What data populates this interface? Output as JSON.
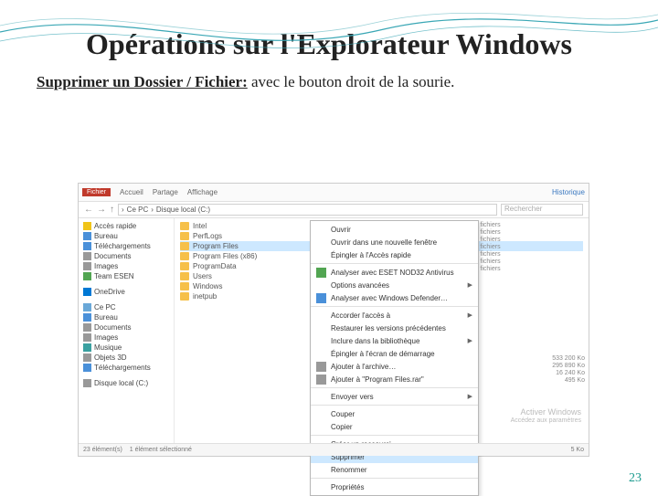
{
  "slide": {
    "title": "Opérations sur l'Explorateur Windows",
    "lead": "Supprimer un  Dossier / Fichier:",
    "rest": " avec le bouton droit de la sourie.",
    "page": "23"
  },
  "explorer": {
    "ribbon": {
      "file": "Fichier",
      "home": "Accueil",
      "share": "Partage",
      "view": "Affichage",
      "history": "Historique"
    },
    "nav": {
      "path_parts": [
        "Ce PC",
        "Disque local (C:)"
      ],
      "search_placeholder": "Rechercher"
    },
    "sidebar": [
      {
        "label": "Accès rapide",
        "icon": "star"
      },
      {
        "label": "Bureau",
        "icon": "blue"
      },
      {
        "label": "Téléchargements",
        "icon": "blue"
      },
      {
        "label": "Documents",
        "icon": "gray"
      },
      {
        "label": "Images",
        "icon": "gray"
      },
      {
        "label": "Team ESEN",
        "icon": "green"
      },
      {
        "sep": true
      },
      {
        "label": "OneDrive",
        "icon": "cloud"
      },
      {
        "sep": true
      },
      {
        "label": "Ce PC",
        "icon": "pc"
      },
      {
        "label": "Bureau",
        "icon": "blue"
      },
      {
        "label": "Documents",
        "icon": "gray"
      },
      {
        "label": "Images",
        "icon": "gray"
      },
      {
        "label": "Musique",
        "icon": "music"
      },
      {
        "label": "Objets 3D",
        "icon": "gray"
      },
      {
        "label": "Téléchargements",
        "icon": "blue"
      },
      {
        "sep": true
      },
      {
        "label": "Disque local (C:)",
        "icon": "gray"
      }
    ],
    "files": [
      "Intel",
      "PerfLogs",
      "Program Files",
      "Program Files (x86)",
      "ProgramData",
      "Users",
      "Windows",
      "inetpub"
    ],
    "selected_file": "Program Files",
    "right_col": [
      {
        "type": "Dossier de fichiers"
      },
      {
        "type": "Dossier de fichiers"
      },
      {
        "type": "Dossier de fichiers"
      },
      {
        "type": "Dossier de fichiers"
      },
      {
        "type": "Dossier de fichiers"
      },
      {
        "type": "Dossier de fichiers"
      },
      {
        "type": "Dossier de fichiers"
      }
    ],
    "sizes": [
      {
        "n": "",
        "v": "533 200 Ko"
      },
      {
        "n": "",
        "v": "295 890 Ko"
      },
      {
        "n": "",
        "v": "16 240 Ko"
      },
      {
        "n": "",
        "v": "495 Ko"
      }
    ],
    "context_menu": [
      {
        "label": "Ouvrir"
      },
      {
        "label": "Ouvrir dans une nouvelle fenêtre"
      },
      {
        "label": "Épingler à l'Accès rapide"
      },
      {
        "sep": true
      },
      {
        "label": "Analyser avec ESET NOD32 Antivirus",
        "icon": "green"
      },
      {
        "label": "Options avancées",
        "arrow": true
      },
      {
        "label": "Analyser avec Windows Defender…",
        "icon": "blue"
      },
      {
        "sep": true
      },
      {
        "label": "Accorder l'accès à",
        "arrow": true
      },
      {
        "label": "Restaurer les versions précédentes"
      },
      {
        "label": "Inclure dans la bibliothèque",
        "arrow": true
      },
      {
        "label": "Épingler à l'écran de démarrage"
      },
      {
        "label": "Ajouter à l'archive…",
        "icon": "gray"
      },
      {
        "label": "Ajouter à \"Program Files.rar\"",
        "icon": "gray"
      },
      {
        "sep": true
      },
      {
        "label": "Envoyer vers",
        "arrow": true
      },
      {
        "sep": true
      },
      {
        "label": "Couper"
      },
      {
        "label": "Copier"
      },
      {
        "sep": true
      },
      {
        "label": "Créer un raccourci"
      },
      {
        "label": "Supprimer",
        "highlight": true
      },
      {
        "label": "Renommer"
      },
      {
        "sep": true
      },
      {
        "label": "Propriétés"
      }
    ],
    "watermark": {
      "l1": "Activer Windows",
      "l2": "Accédez aux paramètres"
    },
    "status": {
      "left": "23 élément(s)",
      "mid": "1 élément sélectionné",
      "right": "5 Ko"
    }
  }
}
